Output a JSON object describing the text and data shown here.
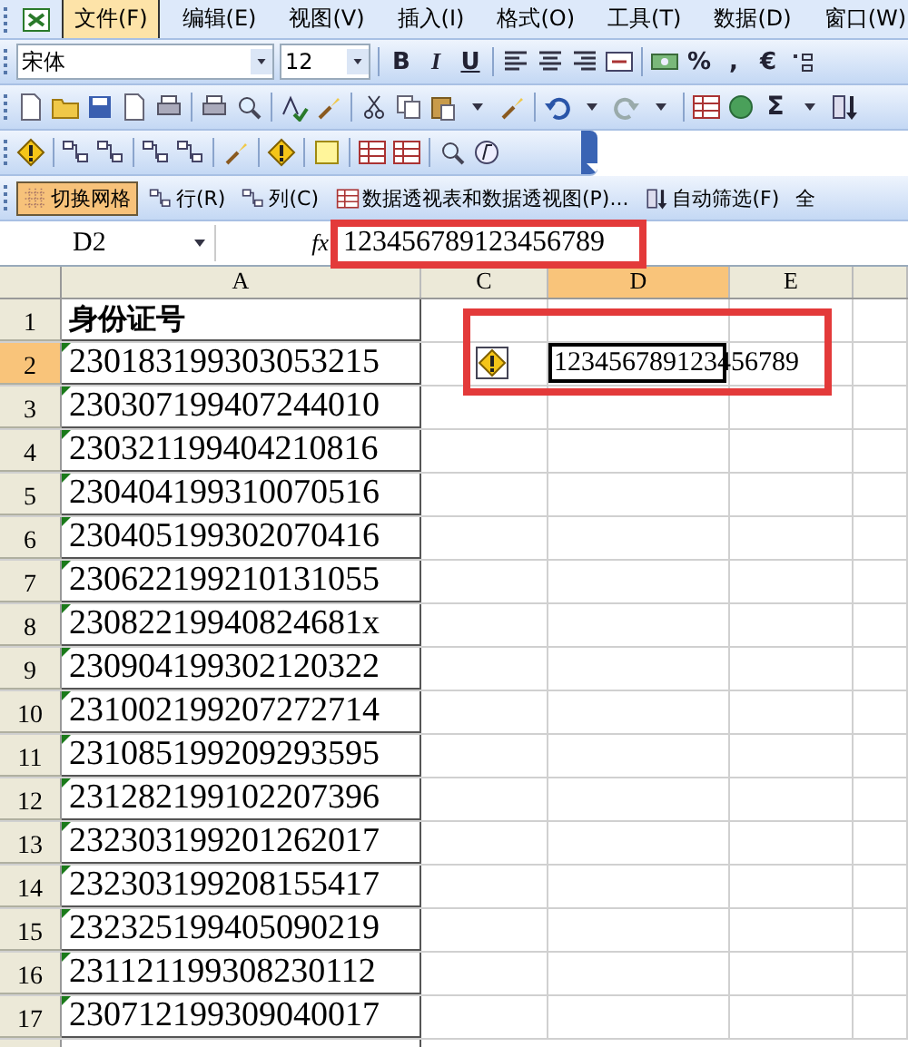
{
  "menu": [
    {
      "label": "文件(F)",
      "selected": true
    },
    {
      "label": "编辑(E)",
      "selected": false
    },
    {
      "label": "视图(V)",
      "selected": false
    },
    {
      "label": "插入(I)",
      "selected": false
    },
    {
      "label": "格式(O)",
      "selected": false
    },
    {
      "label": "工具(T)",
      "selected": false
    },
    {
      "label": "数据(D)",
      "selected": false
    },
    {
      "label": "窗口(W)",
      "selected": false
    }
  ],
  "format_toolbar": {
    "font": "宋体",
    "size": "12",
    "style_buttons": [
      "B",
      "I",
      "U"
    ],
    "number_buttons": [
      "%",
      ",",
      "€"
    ]
  },
  "standard_toolbar": {
    "sum_button": "Σ"
  },
  "pivot_toolbar": [
    {
      "label": "切换网格",
      "selected": true
    },
    {
      "label": "行(R)",
      "selected": false
    },
    {
      "label": "列(C)",
      "selected": false
    },
    {
      "label": "数据透视表和数据透视图(P)...",
      "selected": false
    },
    {
      "label": "自动筛选(F)",
      "selected": false
    },
    {
      "label": "全",
      "selected": false
    }
  ],
  "formula_bar": {
    "name_box": "D2",
    "fx": "fx",
    "value": "123456789123456789",
    "highlighted": true
  },
  "columns": [
    {
      "label": "A",
      "selected": false
    },
    {
      "label": "C",
      "selected": false
    },
    {
      "label": "D",
      "selected": true
    },
    {
      "label": "E",
      "selected": false
    }
  ],
  "rows": [
    {
      "number": "1",
      "selected": false,
      "a": "身份证号",
      "kind": "header",
      "flagged": false,
      "highlighted": false
    },
    {
      "number": "2",
      "selected": true,
      "a": "230183199303053215",
      "kind": "id",
      "flagged": true,
      "d": "123456789123456789",
      "warning": true,
      "highlighted": true
    },
    {
      "number": "3",
      "selected": false,
      "a": "230307199407244010",
      "kind": "id",
      "flagged": true
    },
    {
      "number": "4",
      "selected": false,
      "a": "230321199404210816",
      "kind": "id",
      "flagged": true
    },
    {
      "number": "5",
      "selected": false,
      "a": "230404199310070516",
      "kind": "id",
      "flagged": true
    },
    {
      "number": "6",
      "selected": false,
      "a": "230405199302070416",
      "kind": "id",
      "flagged": true
    },
    {
      "number": "7",
      "selected": false,
      "a": "230622199210131055",
      "kind": "id",
      "flagged": true
    },
    {
      "number": "8",
      "selected": false,
      "a": "23082219940824681x",
      "kind": "id",
      "flagged": true
    },
    {
      "number": "9",
      "selected": false,
      "a": "230904199302120322",
      "kind": "id",
      "flagged": true
    },
    {
      "number": "10",
      "selected": false,
      "a": "231002199207272714",
      "kind": "id",
      "flagged": true
    },
    {
      "number": "11",
      "selected": false,
      "a": "231085199209293595",
      "kind": "id",
      "flagged": true
    },
    {
      "number": "12",
      "selected": false,
      "a": "231282199102207396",
      "kind": "id",
      "flagged": true
    },
    {
      "number": "13",
      "selected": false,
      "a": "232303199201262017",
      "kind": "id",
      "flagged": true
    },
    {
      "number": "14",
      "selected": false,
      "a": "232303199208155417",
      "kind": "id",
      "flagged": true
    },
    {
      "number": "15",
      "selected": false,
      "a": "232325199405090219",
      "kind": "id",
      "flagged": true
    },
    {
      "number": "16",
      "selected": false,
      "a": "231121199308230112",
      "kind": "id",
      "flagged": true
    },
    {
      "number": "17",
      "selected": false,
      "a": "230712199309040017",
      "kind": "id",
      "flagged": true
    }
  ]
}
